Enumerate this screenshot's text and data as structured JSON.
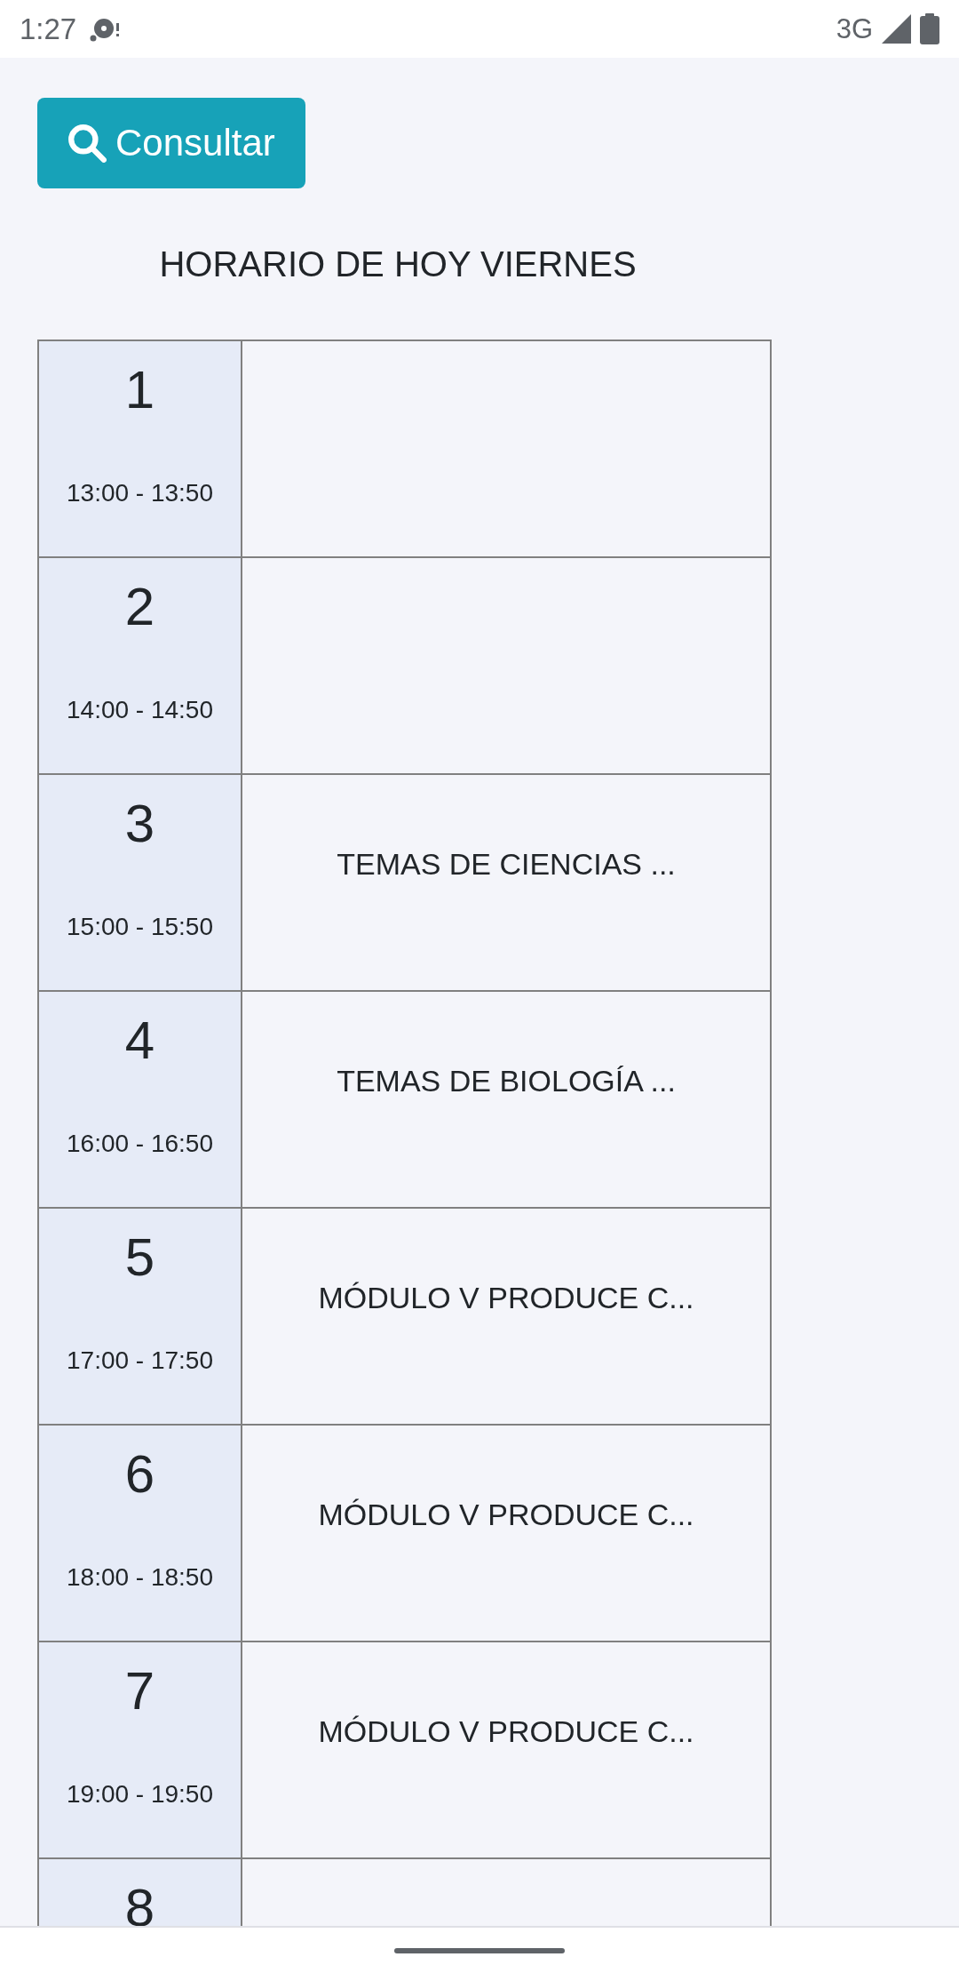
{
  "status_bar": {
    "time": "1:27",
    "network": "3G"
  },
  "consult_button": {
    "label": "Consultar"
  },
  "title": "HORARIO DE HOY VIERNES",
  "schedule": [
    {
      "number": "1",
      "time": "13:00 - 13:50"
    },
    {
      "number": "2",
      "time": "14:00 - 14:50"
    },
    {
      "number": "3",
      "time": "15:00 - 15:50",
      "subject": "TEMAS DE CIENCIAS ..."
    },
    {
      "number": "4",
      "time": "16:00 - 16:50",
      "subject": "TEMAS DE BIOLOGÍA ..."
    },
    {
      "number": "5",
      "time": "17:00 - 17:50",
      "subject": "MÓDULO V PRODUCE C..."
    },
    {
      "number": "6",
      "time": "18:00 - 18:50",
      "subject": "MÓDULO V PRODUCE C..."
    },
    {
      "number": "7",
      "time": "19:00 - 19:50",
      "subject": "MÓDULO V PRODUCE C..."
    },
    {
      "number": "8"
    }
  ]
}
